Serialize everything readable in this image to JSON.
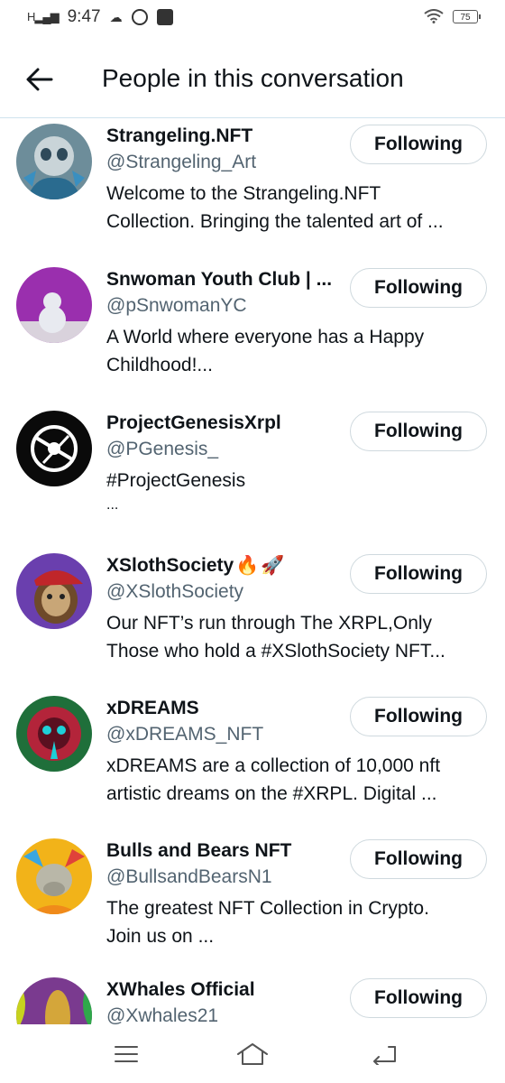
{
  "status_bar": {
    "network": "H",
    "time": "9:47",
    "battery": "75",
    "icons": [
      "signal-icon",
      "wifi-icon",
      "battery-icon",
      "notification-icon",
      "telegram-icon",
      "facebook-icon"
    ]
  },
  "header": {
    "title": "People in this conversation",
    "back_icon": "arrow-left-icon"
  },
  "people": [
    {
      "name": "Strangeling.NFT",
      "handle": "@Strangeling_Art",
      "bio": [
        "Welcome to the Strangeling.NFT",
        "Collection. Bringing the talented art of ..."
      ],
      "button": "Following"
    },
    {
      "name": "Snwoman Youth Club | ...",
      "handle": "@pSnwomanYC",
      "bio": [
        "A World where everyone has a Happy",
        "Childhood!..."
      ],
      "button": "Following"
    },
    {
      "name": "ProjectGenesisXrpl",
      "handle": "@PGenesis_",
      "bio": [
        "#ProjectGenesis",
        "..."
      ],
      "button": "Following"
    },
    {
      "name": "XSlothSociety",
      "name_emoji": [
        "🔥",
        "🚀"
      ],
      "handle": "@XSlothSociety",
      "bio": [
        "Our NFT’s run through The XRPL,Only",
        "Those who hold a #XSlothSociety NFT..."
      ],
      "button": "Following"
    },
    {
      "name": "xDREAMS",
      "handle": "@xDREAMS_NFT",
      "bio": [
        "xDREAMS are a collection of 10,000 nft",
        "artistic dreams on the #XRPL. Digital ..."
      ],
      "button": "Following"
    },
    {
      "name": "Bulls and Bears NFT",
      "handle": "@BullsandBearsN1",
      "bio": [
        "The greatest NFT Collection in Crypto.",
        "Join us on ..."
      ],
      "button": "Following"
    },
    {
      "name": "XWhales Official",
      "handle": "@Xwhales21",
      "bio": [],
      "button": "Following"
    }
  ],
  "nav_bar": {
    "icons": [
      "menu-icon",
      "home-icon",
      "back-icon"
    ]
  }
}
